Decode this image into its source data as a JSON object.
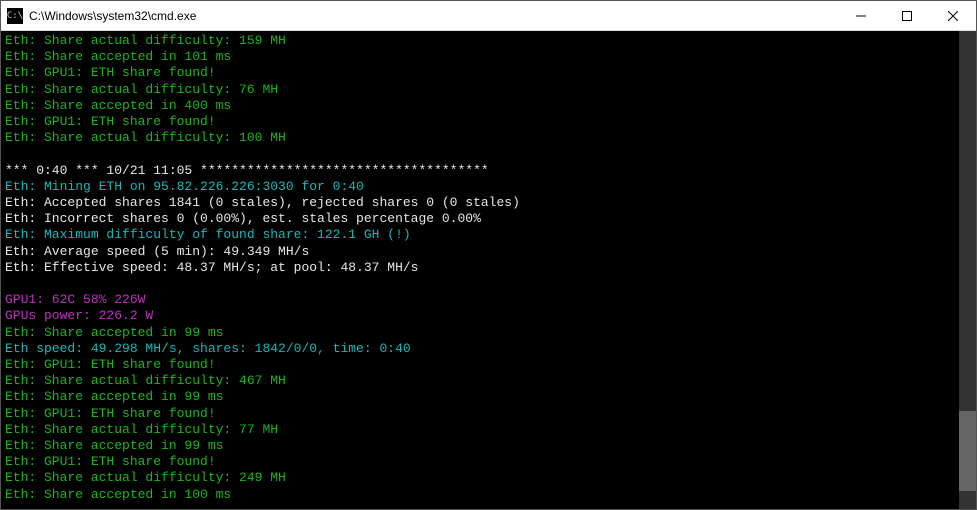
{
  "window": {
    "title": "C:\\Windows\\system32\\cmd.exe"
  },
  "lines": [
    {
      "cls": "c-green",
      "text": "Eth: Share actual difficulty: 159 MH"
    },
    {
      "cls": "c-green",
      "text": "Eth: Share accepted in 101 ms"
    },
    {
      "cls": "c-green",
      "text": "Eth: GPU1: ETH share found!"
    },
    {
      "cls": "c-green",
      "text": "Eth: Share actual difficulty: 76 MH"
    },
    {
      "cls": "c-green",
      "text": "Eth: Share accepted in 400 ms"
    },
    {
      "cls": "c-green",
      "text": "Eth: GPU1: ETH share found!"
    },
    {
      "cls": "c-green",
      "text": "Eth: Share actual difficulty: 100 MH"
    },
    {
      "cls": "",
      "text": " "
    },
    {
      "cls": "c-white",
      "text": "*** 0:40 *** 10/21 11:05 *************************************"
    },
    {
      "cls": "c-cyan",
      "text": "Eth: Mining ETH on 95.82.226.226:3030 for 0:40"
    },
    {
      "cls": "c-white",
      "text": "Eth: Accepted shares 1841 (0 stales), rejected shares 0 (0 stales)"
    },
    {
      "cls": "c-white",
      "text": "Eth: Incorrect shares 0 (0.00%), est. stales percentage 0.00%"
    },
    {
      "cls": "c-cyan",
      "text": "Eth: Maximum difficulty of found share: 122.1 GH (!)"
    },
    {
      "cls": "c-white",
      "text": "Eth: Average speed (5 min): 49.349 MH/s"
    },
    {
      "cls": "c-white",
      "text": "Eth: Effective speed: 48.37 MH/s; at pool: 48.37 MH/s"
    },
    {
      "cls": "",
      "text": " "
    },
    {
      "cls": "c-magenta",
      "text": "GPU1: 62C 58% 226W"
    },
    {
      "cls": "c-magenta",
      "text": "GPUs power: 226.2 W"
    },
    {
      "cls": "c-green",
      "text": "Eth: Share accepted in 99 ms"
    },
    {
      "cls": "c-cyan",
      "text": "Eth speed: 49.298 MH/s, shares: 1842/0/0, time: 0:40"
    },
    {
      "cls": "c-green",
      "text": "Eth: GPU1: ETH share found!"
    },
    {
      "cls": "c-green",
      "text": "Eth: Share actual difficulty: 467 MH"
    },
    {
      "cls": "c-green",
      "text": "Eth: Share accepted in 99 ms"
    },
    {
      "cls": "c-green",
      "text": "Eth: GPU1: ETH share found!"
    },
    {
      "cls": "c-green",
      "text": "Eth: Share actual difficulty: 77 MH"
    },
    {
      "cls": "c-green",
      "text": "Eth: Share accepted in 99 ms"
    },
    {
      "cls": "c-green",
      "text": "Eth: GPU1: ETH share found!"
    },
    {
      "cls": "c-green",
      "text": "Eth: Share actual difficulty: 249 MH"
    },
    {
      "cls": "c-green",
      "text": "Eth: Share accepted in 100 ms"
    }
  ],
  "scroll": {
    "thumbTop": 380,
    "thumbHeight": 80
  }
}
